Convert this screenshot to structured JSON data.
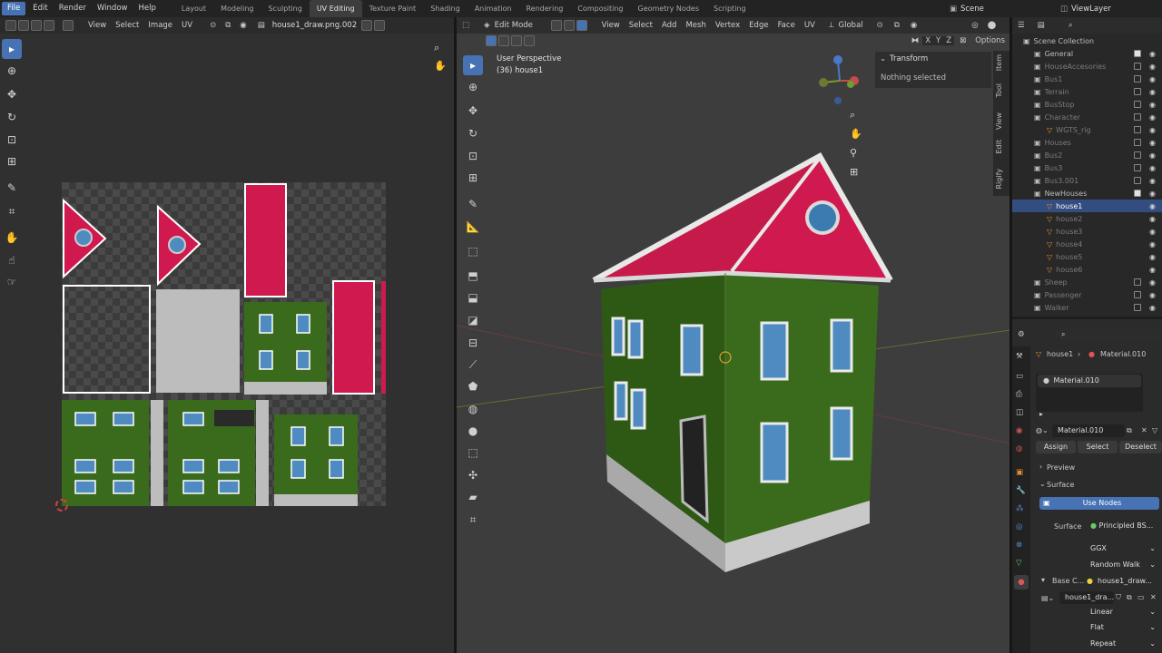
{
  "topbar": {
    "menus": [
      "File",
      "Edit",
      "Render",
      "Window",
      "Help"
    ],
    "workspaces": [
      "Layout",
      "Modeling",
      "Sculpting",
      "UV Editing",
      "Texture Paint",
      "Shading",
      "Animation",
      "Rendering",
      "Compositing",
      "Geometry Nodes",
      "Scripting"
    ],
    "active_workspace": "UV Editing",
    "scene": "Scene",
    "view_layer": "ViewLayer"
  },
  "uv_editor": {
    "header": {
      "view": "View",
      "select": "Select",
      "image": "Image",
      "uv": "UV",
      "image_name": "house1_draw.png.002"
    }
  },
  "viewport": {
    "header": {
      "mode": "Edit Mode",
      "view": "View",
      "select": "Select",
      "add": "Add",
      "mesh": "Mesh",
      "vertex": "Vertex",
      "edge": "Edge",
      "face": "Face",
      "uv": "UV",
      "orientation": "Global",
      "options": "Options"
    },
    "axes": [
      "X",
      "Y",
      "Z"
    ],
    "overlay_line1": "User Perspective",
    "overlay_line2": "(36) house1",
    "transform_title": "Transform",
    "transform_text": "Nothing selected",
    "side_tabs": [
      "Item",
      "Tool",
      "View",
      "Edit",
      "Rigify"
    ]
  },
  "outliner": {
    "title": "Scene Collection",
    "rows": [
      {
        "name": "General",
        "indent": 1,
        "dim": false,
        "checked": true
      },
      {
        "name": "HouseAccesories",
        "indent": 1,
        "dim": true,
        "checked": false
      },
      {
        "name": "Bus1",
        "indent": 1,
        "dim": true,
        "checked": false
      },
      {
        "name": "Terrain",
        "indent": 1,
        "dim": true,
        "checked": false
      },
      {
        "name": "BusStop",
        "indent": 1,
        "dim": true,
        "checked": false
      },
      {
        "name": "Character",
        "indent": 1,
        "dim": true,
        "checked": false
      },
      {
        "name": "WGTS_rig",
        "indent": 2,
        "dim": true,
        "checked": false
      },
      {
        "name": "Houses",
        "indent": 1,
        "dim": true,
        "checked": false
      },
      {
        "name": "Bus2",
        "indent": 1,
        "dim": true,
        "checked": false
      },
      {
        "name": "Bus3",
        "indent": 1,
        "dim": true,
        "checked": false
      },
      {
        "name": "Bus3.001",
        "indent": 1,
        "dim": true,
        "checked": false
      },
      {
        "name": "NewHouses",
        "indent": 1,
        "dim": false,
        "checked": true
      },
      {
        "name": "house1",
        "indent": 2,
        "dim": false,
        "sel": true
      },
      {
        "name": "house2",
        "indent": 2,
        "dim": true
      },
      {
        "name": "house3",
        "indent": 2,
        "dim": true
      },
      {
        "name": "house4",
        "indent": 2,
        "dim": true
      },
      {
        "name": "house5",
        "indent": 2,
        "dim": true
      },
      {
        "name": "house6",
        "indent": 2,
        "dim": true
      },
      {
        "name": "Sheep",
        "indent": 1,
        "dim": true,
        "checked": false
      },
      {
        "name": "Passenger",
        "indent": 1,
        "dim": true,
        "checked": false
      },
      {
        "name": "Walker",
        "indent": 1,
        "dim": true,
        "checked": false
      }
    ]
  },
  "properties": {
    "breadcrumb_object": "house1",
    "breadcrumb_material": "Material.010",
    "slot": "Material.010",
    "material_name": "Material.010",
    "assign": "Assign",
    "select": "Select",
    "deselect": "Deselect",
    "preview": "Preview",
    "surface_panel": "Surface",
    "use_nodes": "Use Nodes",
    "surface_label": "Surface",
    "surface_value": "Principled BS...",
    "distribution": "GGX",
    "subsurface": "Random Walk",
    "base_color_label": "Base C...",
    "base_color_value": "house1_draw...",
    "image_name": "house1_dra...",
    "interpolation": "Linear",
    "projection": "Flat",
    "extension": "Repeat"
  },
  "colors": {
    "accent": "#4772b3",
    "roof": "#d01a4f",
    "wall": "#3a6a1b",
    "window": "#4f8bc0",
    "base": "#c9c9c9"
  }
}
